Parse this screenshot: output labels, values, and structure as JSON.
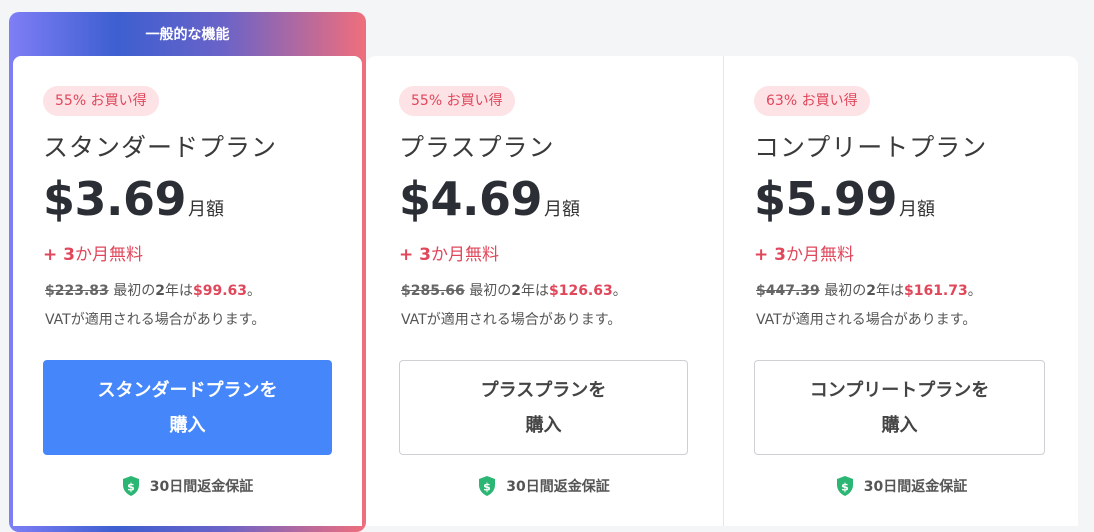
{
  "featured": {
    "tag": "一般的な機能"
  },
  "colors": {
    "accent_blue": "#4587fb",
    "sale_red": "#e0475b",
    "shield_green": "#2bb673"
  },
  "plans": [
    {
      "badge": "55% お買い得",
      "name": "スタンダードプラン",
      "price": "$3.69",
      "price_unit": "月額",
      "bonus_plus": "+ ",
      "bonus_num": "3",
      "bonus_text": "か月無料",
      "old_price": "$223.83",
      "mid_text": " 最初の",
      "years": "2",
      "years_suffix": "年は",
      "new_price": "$99.63",
      "end_mark": "。",
      "vat": "VATが適用される場合があります。",
      "cta_line1": "スタンダードプランを",
      "cta_line2": "購入",
      "guarantee": "30日間返金保証"
    },
    {
      "badge": "55% お買い得",
      "name": "プラスプラン",
      "price": "$4.69",
      "price_unit": "月額",
      "bonus_plus": "+ ",
      "bonus_num": "3",
      "bonus_text": "か月無料",
      "old_price": "$285.66",
      "mid_text": " 最初の",
      "years": "2",
      "years_suffix": "年は",
      "new_price": "$126.63",
      "end_mark": "。",
      "vat": "VATが適用される場合があります。",
      "cta_line1": "プラスプランを",
      "cta_line2": "購入",
      "guarantee": "30日間返金保証"
    },
    {
      "badge": "63% お買い得",
      "name": "コンプリートプラン",
      "price": "$5.99",
      "price_unit": "月額",
      "bonus_plus": "+ ",
      "bonus_num": "3",
      "bonus_text": "か月無料",
      "old_price": "$447.39",
      "mid_text": " 最初の",
      "years": "2",
      "years_suffix": "年は",
      "new_price": "$161.73",
      "end_mark": "。",
      "vat": "VATが適用される場合があります。",
      "cta_line1": "コンプリートプランを",
      "cta_line2": "購入",
      "guarantee": "30日間返金保証"
    }
  ]
}
